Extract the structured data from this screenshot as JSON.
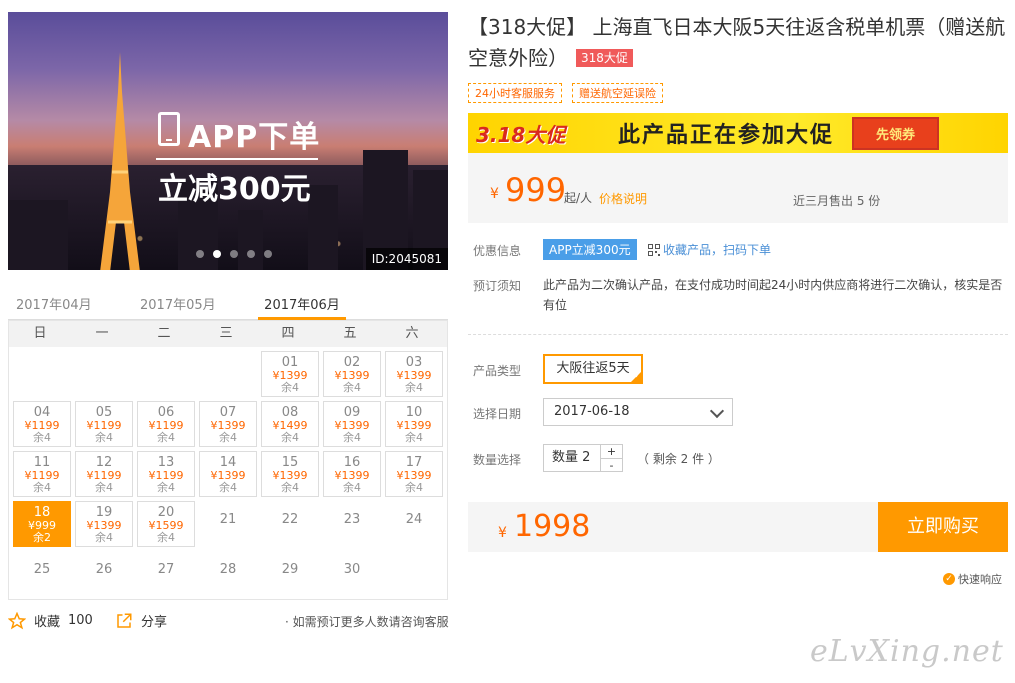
{
  "hero": {
    "promo_line1": "APP下单",
    "promo_line2": "立减300元",
    "id_tag": "ID:2045081"
  },
  "months": [
    "2017年04月",
    "2017年05月",
    "2017年06月"
  ],
  "weekdays": [
    "日",
    "一",
    "二",
    "三",
    "四",
    "五",
    "六"
  ],
  "calendar": {
    "days": [
      {
        "d": "01",
        "p": "¥1399",
        "s": "余4"
      },
      {
        "d": "02",
        "p": "¥1399",
        "s": "余4"
      },
      {
        "d": "03",
        "p": "¥1399",
        "s": "余4"
      },
      {
        "d": "04",
        "p": "¥1199",
        "s": "余4"
      },
      {
        "d": "05",
        "p": "¥1199",
        "s": "余4"
      },
      {
        "d": "06",
        "p": "¥1199",
        "s": "余4"
      },
      {
        "d": "07",
        "p": "¥1399",
        "s": "余4"
      },
      {
        "d": "08",
        "p": "¥1499",
        "s": "余4"
      },
      {
        "d": "09",
        "p": "¥1399",
        "s": "余4"
      },
      {
        "d": "10",
        "p": "¥1399",
        "s": "余4"
      },
      {
        "d": "11",
        "p": "¥1199",
        "s": "余4"
      },
      {
        "d": "12",
        "p": "¥1199",
        "s": "余4"
      },
      {
        "d": "13",
        "p": "¥1199",
        "s": "余4"
      },
      {
        "d": "14",
        "p": "¥1399",
        "s": "余4"
      },
      {
        "d": "15",
        "p": "¥1399",
        "s": "余4"
      },
      {
        "d": "16",
        "p": "¥1399",
        "s": "余4"
      },
      {
        "d": "17",
        "p": "¥1399",
        "s": "余4"
      },
      {
        "d": "18",
        "p": "¥999",
        "s": "余2",
        "selected": true
      },
      {
        "d": "19",
        "p": "¥1399",
        "s": "余4"
      },
      {
        "d": "20",
        "p": "¥1599",
        "s": "余4"
      },
      {
        "d": "21"
      },
      {
        "d": "22"
      },
      {
        "d": "23"
      },
      {
        "d": "24"
      },
      {
        "d": "25"
      },
      {
        "d": "26"
      },
      {
        "d": "27"
      },
      {
        "d": "28"
      },
      {
        "d": "29"
      },
      {
        "d": "30"
      }
    ]
  },
  "bottom_left": {
    "fav_label": "收藏",
    "fav_count": "100",
    "share_label": "分享",
    "consult": "如需预订更多人数请咨询客服"
  },
  "product": {
    "title": "【318大促】 上海直飞日本大阪5天往返含税单机票（赠送航空意外险）",
    "badge": "318大促",
    "tags": [
      "24小时客服服务",
      "赠送航空延误险"
    ],
    "banner_left": "3.18大促",
    "banner_mid": "此产品正在参加大促",
    "banner_btn": "先领券",
    "yen": "¥",
    "price": "999",
    "unit": "起/人",
    "explain": "价格说明",
    "sold": "近三月售出 5 份"
  },
  "rows": {
    "discount_label": "优惠信息",
    "app_badge": "APP立减300元",
    "qr_link": "收藏产品，扫码下单",
    "notice_label": "预订须知",
    "notice_text": "此产品为二次确认产品，在支付成功时间起24小时内供应商将进行二次确认，核实是否有位",
    "type_label": "产品类型",
    "type_value": "大阪往返5天",
    "date_label": "选择日期",
    "date_value": "2017-06-18",
    "qty_label": "数量选择",
    "qty_value": "数量  2",
    "qty_plus": "+",
    "qty_minus": "-",
    "remain": "（ 剩余 2 件 ）"
  },
  "total": {
    "yen": "¥",
    "amount": "1998",
    "buy": "立即购买",
    "quick": "快速响应"
  },
  "watermark": "eLvXing.net",
  "colors": {
    "accent": "#ff9900",
    "price": "#ff6600",
    "link": "#4a8fd6"
  }
}
